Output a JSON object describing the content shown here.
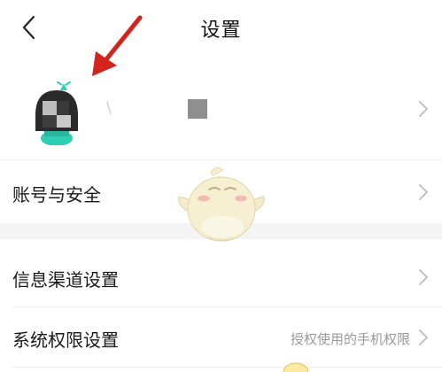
{
  "header": {
    "title": "设置"
  },
  "icons": {
    "back": "back-icon",
    "chevron": "chevron-right-icon",
    "annotation_arrow": "red-arrow-icon",
    "mascot": "mascot-watermark"
  },
  "colors": {
    "text_primary": "#1a1a1a",
    "text_secondary": "#9a9a9a",
    "chevron": "#c2c2c2",
    "section_gap": "#f4f4f4",
    "annotation_arrow": "#d4221c",
    "avatar_accent": "#2fcfb4"
  },
  "settings": {
    "account_security": {
      "label": "账号与安全"
    },
    "info_channel": {
      "label": "信息渠道设置"
    },
    "system_permissions": {
      "label": "系统权限设置",
      "value": "授权使用的手机权限"
    }
  }
}
